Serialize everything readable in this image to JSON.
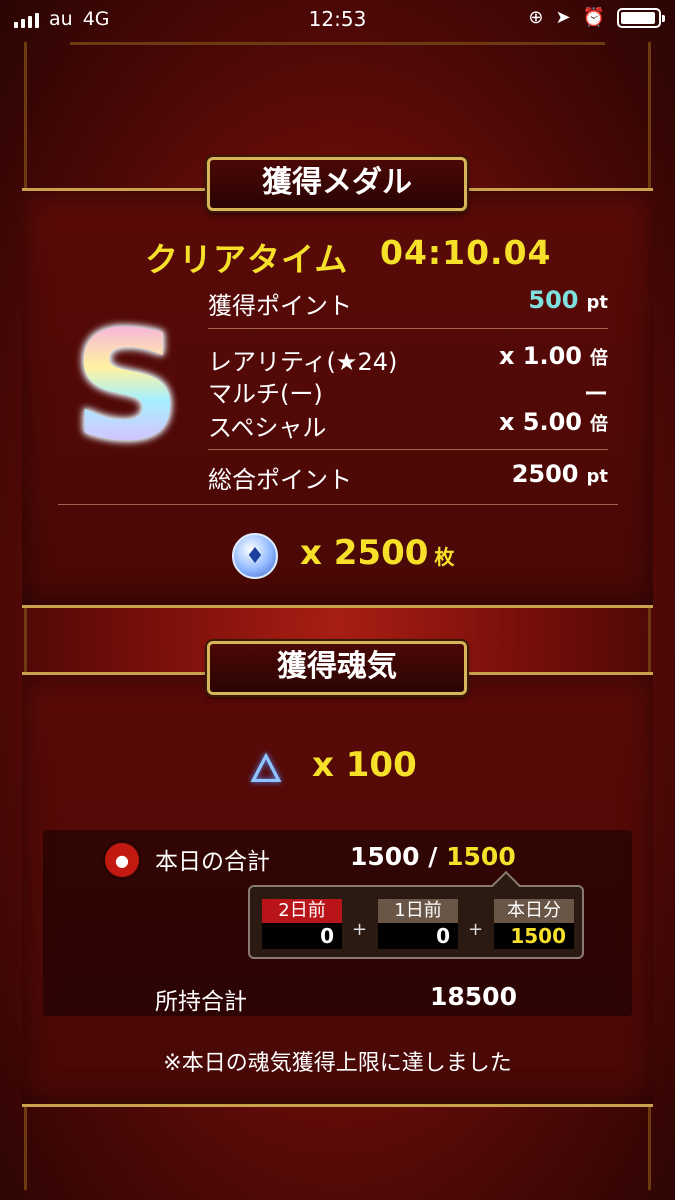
{
  "status_bar": {
    "carrier": "au",
    "network": "4G",
    "time": "12:53"
  },
  "medal_section": {
    "title": "獲得メダル",
    "clear_time_label": "クリアタイム",
    "clear_time_value": "04:10.04",
    "rank": "S",
    "rows": [
      {
        "label": "獲得ポイント",
        "value": "500",
        "unit": "pt"
      },
      {
        "label": "レアリティ(★24)",
        "value": "x 1.00",
        "unit": "倍"
      },
      {
        "label": "マルチ(ー)",
        "value": "ー",
        "unit": ""
      },
      {
        "label": "スペシャル",
        "value": "x 5.00",
        "unit": "倍"
      },
      {
        "label": "総合ポイント",
        "value": "2500",
        "unit": "pt"
      }
    ],
    "medal_count": "x 2500",
    "medal_unit": "枚"
  },
  "soul_section": {
    "title": "獲得魂気",
    "soul_count": "x 100",
    "today_total_label": "本日の合計",
    "today_total_current": "1500 /",
    "today_total_max": "1500",
    "days": [
      {
        "label": "2日前",
        "value": "0"
      },
      {
        "label": "1日前",
        "value": "0"
      },
      {
        "label": "本日分",
        "value": "1500"
      }
    ],
    "plus_sign": "+",
    "owned_total_label": "所持合計",
    "owned_total_value": "18500",
    "notice": "※本日の魂気獲得上限に達しました"
  }
}
